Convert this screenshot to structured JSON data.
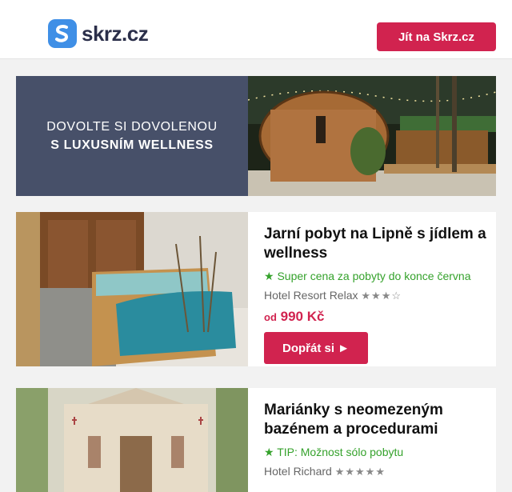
{
  "header": {
    "logo_text": "skrz.cz",
    "cta_label": "Jít na Skrz.cz"
  },
  "banner": {
    "line1": "DOVOLTE SI DOVOLENOU",
    "line2": "S LUXUSNÍM WELLNESS"
  },
  "offers": [
    {
      "title": "Jarní pobyt na Lipně s jídlem a wellness",
      "tip": "★ Super cena za pobyty do konce června",
      "hotel": "Hotel Resort Relax",
      "stars": "★★★☆",
      "price_prefix": "od",
      "price": "990 Kč",
      "button_label": "Dopřát si ►"
    },
    {
      "title": "Mariánky s neomezeným bazénem a procedurami",
      "tip": "★ TIP: Možnost sólo pobytu",
      "hotel": "Hotel Richard",
      "stars": "★★★★★"
    }
  ],
  "colors": {
    "brand": "#d1234f",
    "logo_blue": "#3f8fe6",
    "banner_bg": "#475069",
    "tip_green": "#35a22c"
  }
}
